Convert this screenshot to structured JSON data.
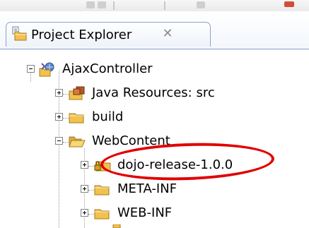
{
  "tab": {
    "label": "Project Explorer",
    "close_glyph": "✕"
  },
  "tree": {
    "items": [
      {
        "label": "AjaxController",
        "icon": "web-project-icon",
        "state": "expanded"
      },
      {
        "label": "Java Resources: src",
        "icon": "java-resources-icon",
        "state": "collapsed"
      },
      {
        "label": "build",
        "icon": "folder-icon",
        "state": "collapsed"
      },
      {
        "label": "WebContent",
        "icon": "open-folder-icon",
        "state": "expanded"
      },
      {
        "label": "dojo-release-1.0.0",
        "icon": "locked-folder-icon",
        "state": "collapsed",
        "highlighted": true
      },
      {
        "label": "META-INF",
        "icon": "folder-icon",
        "state": "collapsed"
      },
      {
        "label": "WEB-INF",
        "icon": "folder-icon",
        "state": "collapsed"
      }
    ]
  },
  "colors": {
    "folder": "#f2c14e",
    "tab_border": "#8da2c9",
    "annotation": "#e00000"
  }
}
